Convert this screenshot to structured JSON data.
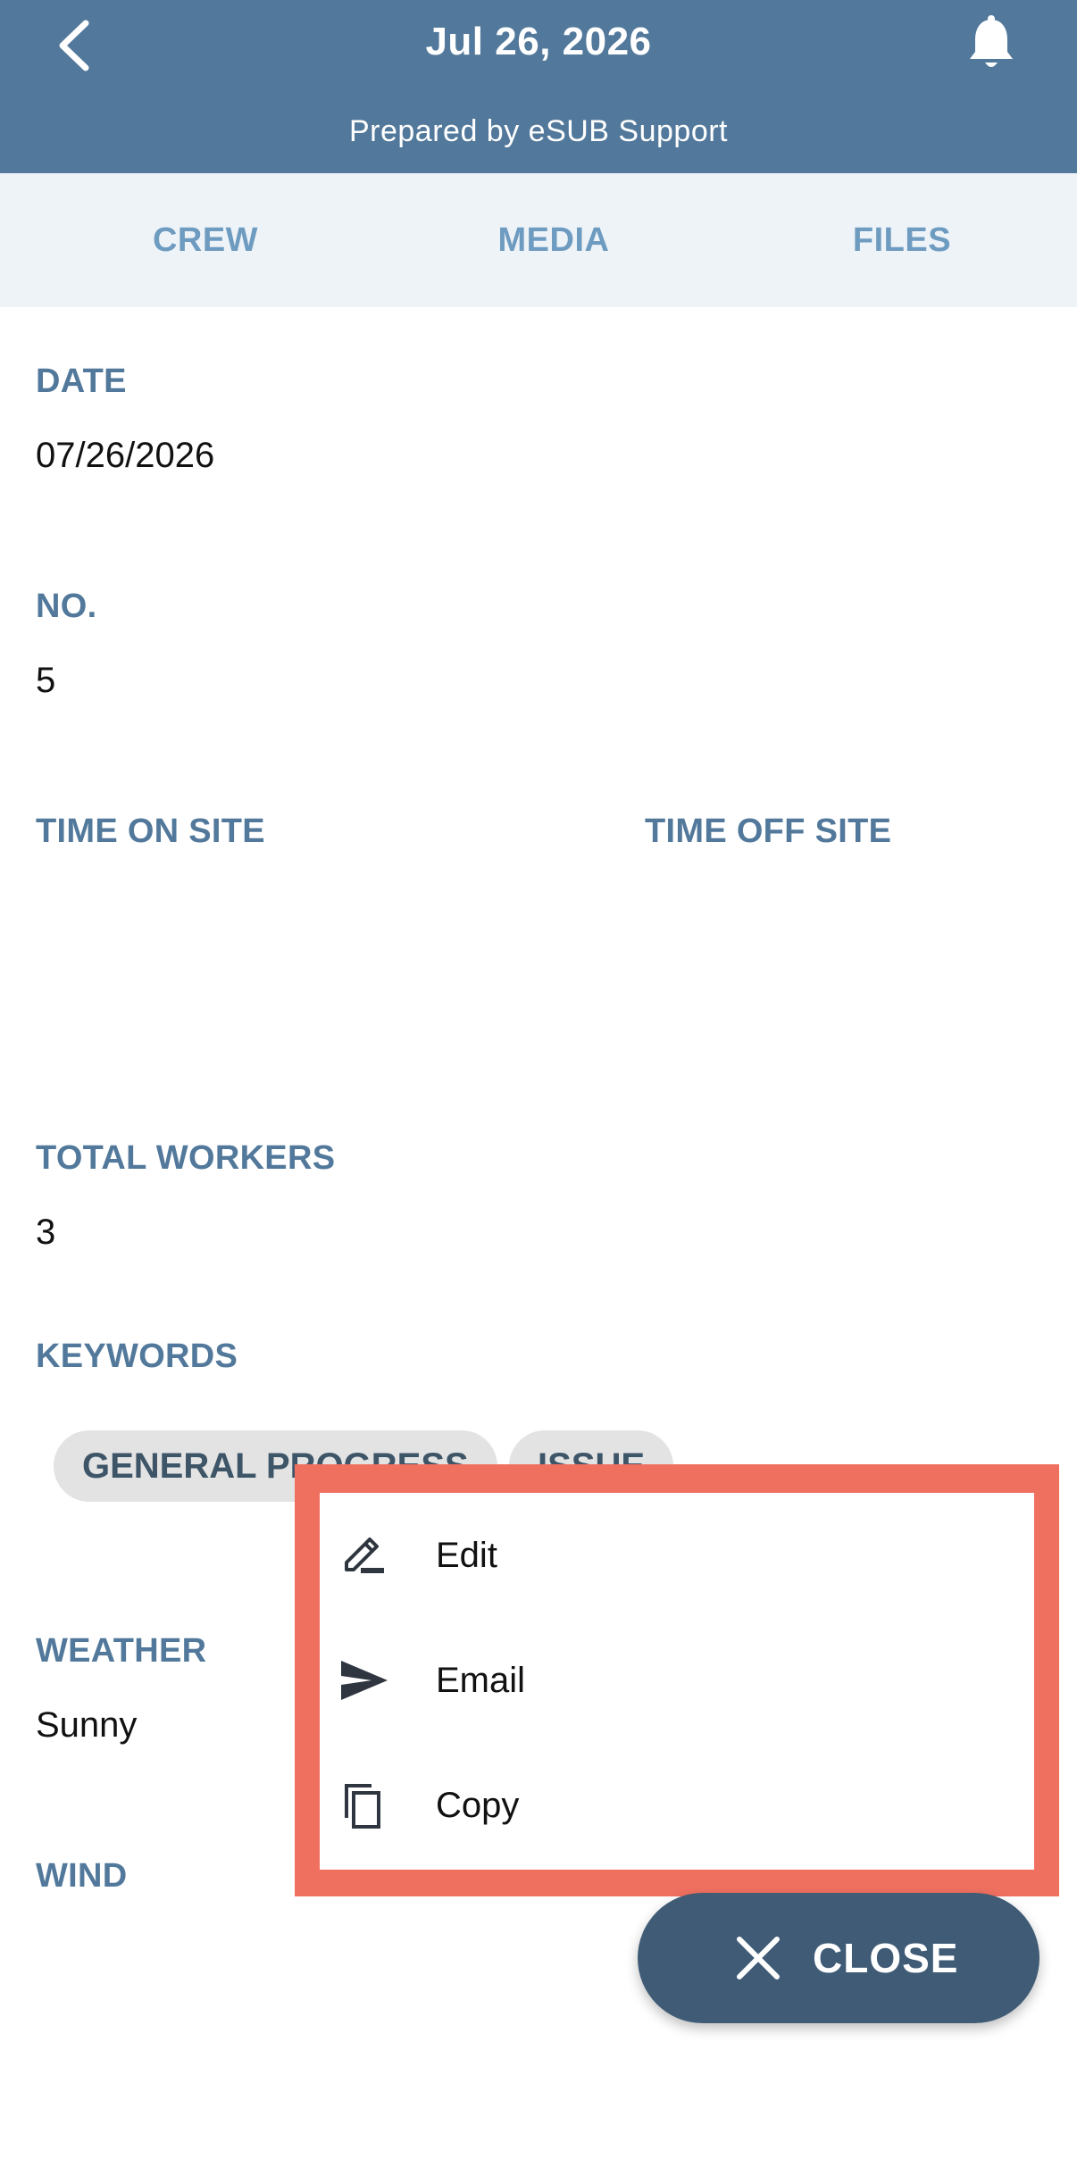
{
  "header": {
    "title": "Jul 26, 2026",
    "subtitle": "Prepared by eSUB Support",
    "back_icon": "chevron-left-icon",
    "notification_icon": "bell-icon"
  },
  "tabs": [
    {
      "label": "CREW"
    },
    {
      "label": "MEDIA"
    },
    {
      "label": "FILES"
    }
  ],
  "fields": {
    "date": {
      "label": "DATE",
      "value": "07/26/2026"
    },
    "no": {
      "label": "NO.",
      "value": "5"
    },
    "time_on_site": {
      "label": "TIME ON SITE",
      "value": ""
    },
    "time_off_site": {
      "label": "TIME OFF SITE",
      "value": ""
    },
    "total_workers": {
      "label": "TOTAL WORKERS",
      "value": "3"
    },
    "keywords": {
      "label": "KEYWORDS",
      "chips": [
        "GENERAL PROGRESS",
        "ISSUE"
      ]
    },
    "weather": {
      "label": "WEATHER",
      "value": "Sunny"
    },
    "wind": {
      "label": "WIND",
      "value": ""
    }
  },
  "action_menu": {
    "items": [
      {
        "label": "Edit",
        "icon": "edit-pencil-icon"
      },
      {
        "label": "Email",
        "icon": "send-icon"
      },
      {
        "label": "Copy",
        "icon": "copy-icon"
      }
    ]
  },
  "close_button": {
    "label": "CLOSE",
    "icon": "close-icon"
  },
  "colors": {
    "header_bg": "#52799b",
    "tab_bar_bg": "#eef3f8",
    "tab_text": "#6e9bc0",
    "label": "#52799b",
    "chip_bg": "#e3e3e3",
    "highlight": "#f07060",
    "fab_bg": "#3f5b75"
  }
}
